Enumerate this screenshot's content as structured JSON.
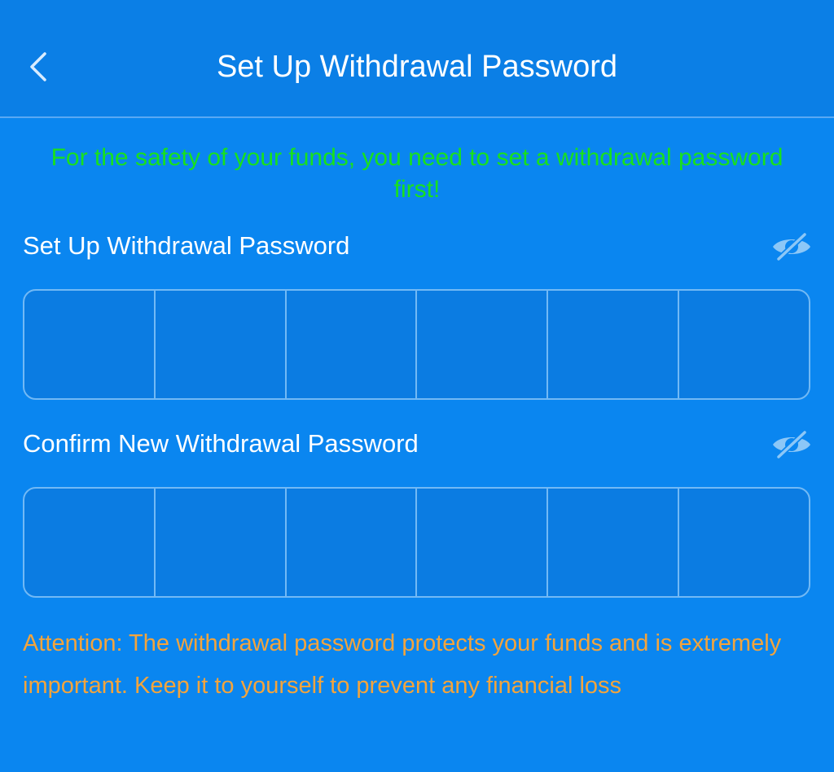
{
  "header": {
    "title": "Set Up Withdrawal Password",
    "back_icon": "chevron-left-icon"
  },
  "notice": {
    "text": "For the safety of your funds, you need to set a withdrawal password first!",
    "color": "#18e11d"
  },
  "password_field": {
    "label": "Set Up Withdrawal Password",
    "visibility_icon": "eye-off-icon",
    "digits": 6
  },
  "confirm_field": {
    "label": "Confirm New Withdrawal Password",
    "visibility_icon": "eye-off-icon",
    "digits": 6
  },
  "attention": {
    "text": "Attention: The withdrawal password protects your funds and is extremely important. Keep it to yourself to prevent any financial loss",
    "color": "#f3a43c"
  },
  "colors": {
    "background": "#0a86f0",
    "header_background": "#0b7fe6",
    "cell_border": "#72b9f5"
  }
}
